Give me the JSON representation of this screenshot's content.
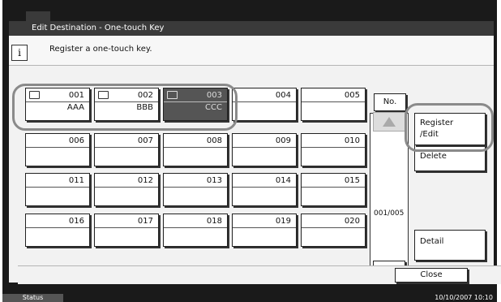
{
  "window": {
    "title": "Edit Destination - One-touch Key"
  },
  "message": {
    "text": "Register a one-touch key."
  },
  "keys": [
    {
      "num": "001",
      "name": "AAA",
      "group": true
    },
    {
      "num": "002",
      "name": "BBB",
      "group": true
    },
    {
      "num": "003",
      "name": "CCC",
      "group": true
    },
    {
      "num": "004",
      "name": ""
    },
    {
      "num": "005",
      "name": ""
    },
    {
      "num": "006",
      "name": ""
    },
    {
      "num": "007",
      "name": ""
    },
    {
      "num": "008",
      "name": ""
    },
    {
      "num": "009",
      "name": ""
    },
    {
      "num": "010",
      "name": ""
    },
    {
      "num": "011",
      "name": ""
    },
    {
      "num": "012",
      "name": ""
    },
    {
      "num": "013",
      "name": ""
    },
    {
      "num": "014",
      "name": ""
    },
    {
      "num": "015",
      "name": ""
    },
    {
      "num": "016",
      "name": ""
    },
    {
      "num": "017",
      "name": ""
    },
    {
      "num": "018",
      "name": ""
    },
    {
      "num": "019",
      "name": ""
    },
    {
      "num": "020",
      "name": ""
    }
  ],
  "selected_key": "003",
  "no_button": {
    "label": "No."
  },
  "pager": {
    "indicator": "001/005"
  },
  "side": {
    "register_label_1": "Register",
    "register_label_2": "/Edit",
    "delete_label": "Delete",
    "detail_label": "Detail"
  },
  "footer": {
    "close_label": "Close"
  },
  "statusbar": {
    "status_label": "Status",
    "datetime": "10/10/2007   10:10"
  }
}
